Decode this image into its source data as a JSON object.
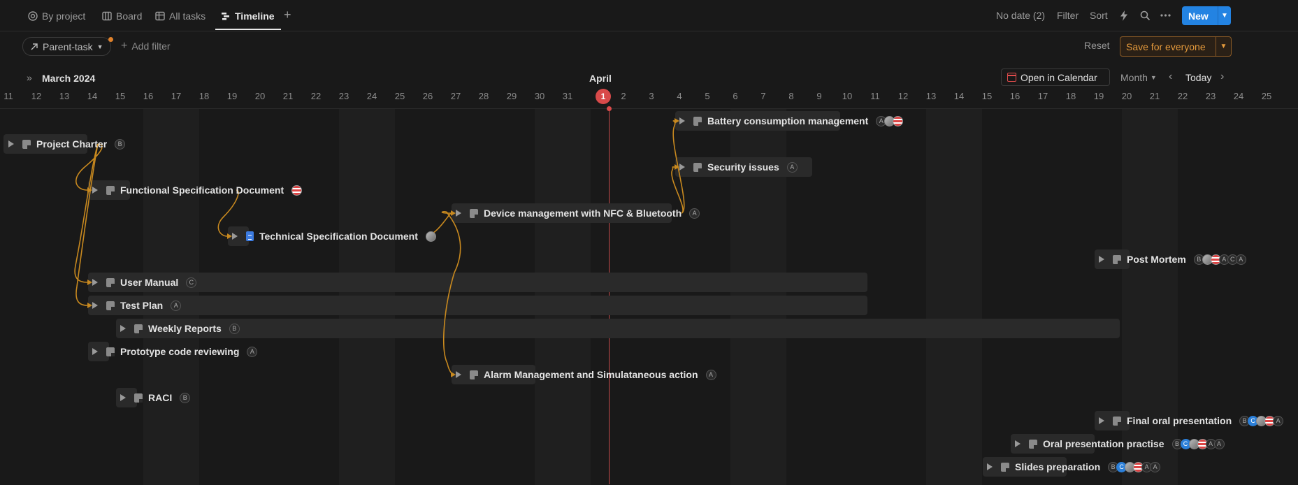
{
  "tabs": [
    {
      "label": "By project",
      "icon": "target-icon"
    },
    {
      "label": "Board",
      "icon": "board-icon"
    },
    {
      "label": "All tasks",
      "icon": "table-icon"
    },
    {
      "label": "Timeline",
      "icon": "timeline-icon",
      "active": true
    }
  ],
  "toolbar": {
    "no_date": "No date (2)",
    "filter": "Filter",
    "sort": "Sort",
    "new_label": "New"
  },
  "filters": {
    "parent_task": "Parent-task",
    "add_filter": "Add filter",
    "reset": "Reset",
    "save_for_everyone": "Save for everyone"
  },
  "timeline": {
    "month_left": "March 2024",
    "month_mid": "April",
    "open_in_calendar": "Open in Calendar",
    "scale": "Month",
    "today": "Today",
    "today_day": "1",
    "days": [
      "11",
      "12",
      "13",
      "14",
      "15",
      "16",
      "17",
      "18",
      "19",
      "20",
      "21",
      "22",
      "23",
      "24",
      "25",
      "26",
      "27",
      "28",
      "29",
      "30",
      "31",
      "1",
      "2",
      "3",
      "4",
      "5",
      "6",
      "7",
      "8",
      "9",
      "10",
      "11",
      "12",
      "13",
      "14",
      "15",
      "16",
      "17",
      "18",
      "19",
      "20",
      "21",
      "22",
      "23",
      "24",
      "25"
    ]
  },
  "tasks": [
    {
      "title": "Project Charter",
      "assignees": [
        "B"
      ]
    },
    {
      "title": "Functional Specification Document",
      "assignees": [
        "flag"
      ]
    },
    {
      "title": "Technical Specification Document",
      "assignees": [
        "photo"
      ]
    },
    {
      "title": "User Manual",
      "assignees": [
        "C"
      ]
    },
    {
      "title": "Test Plan",
      "assignees": [
        "A"
      ]
    },
    {
      "title": "Weekly Reports",
      "assignees": [
        "B"
      ]
    },
    {
      "title": "Prototype code reviewing",
      "assignees": [
        "A"
      ]
    },
    {
      "title": "RACI",
      "assignees": [
        "B"
      ]
    },
    {
      "title": "Device management with NFC & Bluetooth",
      "assignees": [
        "A"
      ]
    },
    {
      "title": "Alarm Management and Simulataneous action",
      "assignees": [
        "A"
      ]
    },
    {
      "title": "Battery consumption management",
      "assignees": [
        "A",
        "photo",
        "flag"
      ]
    },
    {
      "title": "Security issues",
      "assignees": [
        "A"
      ]
    },
    {
      "title": "Post Mortem",
      "assignees": [
        "B",
        "photo",
        "flag",
        "A",
        "C",
        "A"
      ]
    },
    {
      "title": "Final oral presentation",
      "assignees": [
        "B",
        "C",
        "photo",
        "flag",
        "A"
      ]
    },
    {
      "title": "Oral presentation practise",
      "assignees": [
        "B",
        "C",
        "photo",
        "flag",
        "A",
        "A"
      ]
    },
    {
      "title": "Slides preparation",
      "assignees": [
        "B",
        "C",
        "photo",
        "flag",
        "A",
        "A"
      ]
    }
  ]
}
